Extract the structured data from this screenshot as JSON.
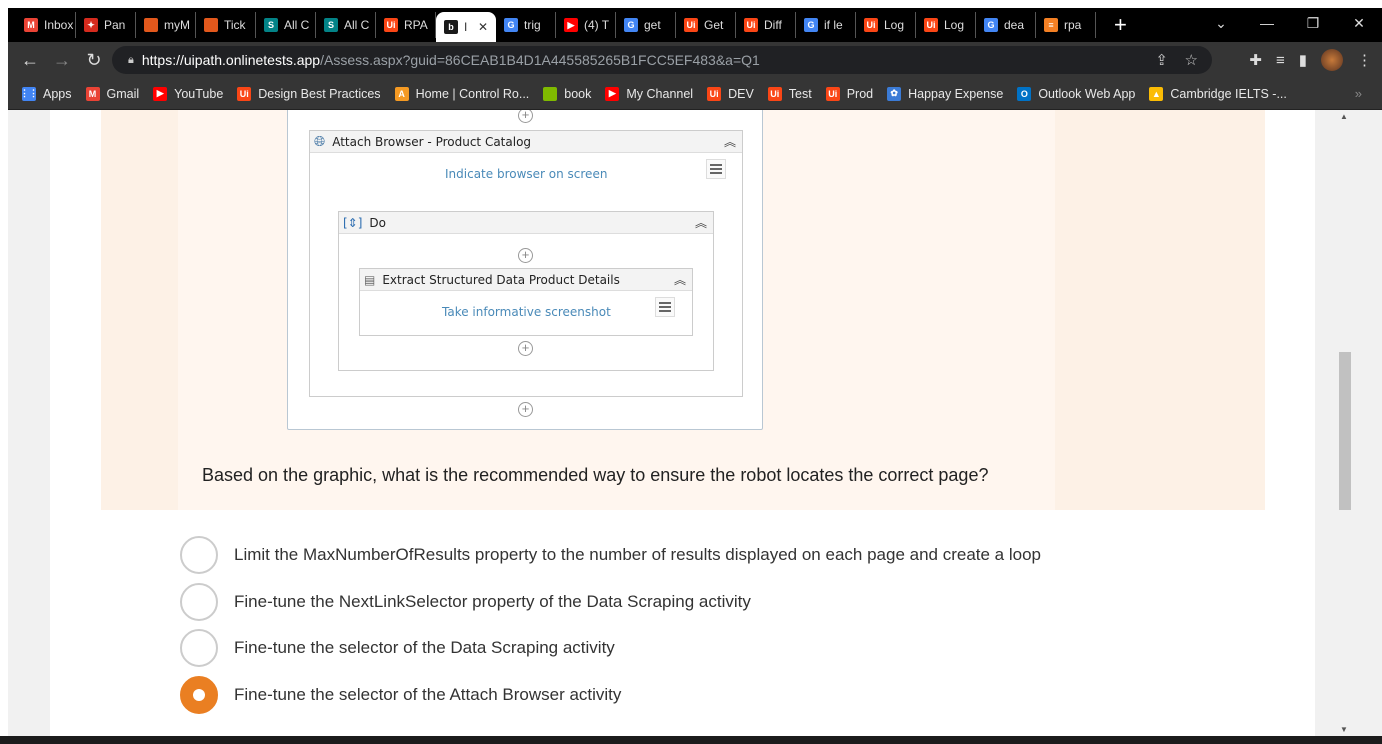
{
  "browser": {
    "tabs": [
      {
        "label": "Inbox",
        "icon": "gmail-icon",
        "color": "#ea4335"
      },
      {
        "label": "Pan",
        "icon": "maple-leaf-icon",
        "color": "#d52b1e"
      },
      {
        "label": "myM",
        "icon": "office-icon",
        "color": "#e2581c"
      },
      {
        "label": "Tick",
        "icon": "office-icon",
        "color": "#e2581c"
      },
      {
        "label": "All C",
        "icon": "sharepoint-icon",
        "color": "#038387"
      },
      {
        "label": "All C",
        "icon": "sharepoint-icon",
        "color": "#038387"
      },
      {
        "label": "RPA",
        "icon": "uipath-icon",
        "color": "#fa4616"
      },
      {
        "label": "I",
        "icon": "onlinetests-icon",
        "color": "#1a1a1a",
        "active": true
      },
      {
        "label": "trig",
        "icon": "google-icon",
        "color": "#4285f4"
      },
      {
        "label": "(4) T",
        "icon": "youtube-icon",
        "color": "#ff0000"
      },
      {
        "label": "get",
        "icon": "google-icon",
        "color": "#4285f4"
      },
      {
        "label": "Get",
        "icon": "uipath-icon",
        "color": "#fa4616"
      },
      {
        "label": "Diff",
        "icon": "uipath-icon",
        "color": "#fa4616"
      },
      {
        "label": "if le",
        "icon": "google-icon",
        "color": "#4285f4"
      },
      {
        "label": "Log",
        "icon": "uipath-icon",
        "color": "#fa4616"
      },
      {
        "label": "Log",
        "icon": "uipath-icon",
        "color": "#fa4616"
      },
      {
        "label": "dea",
        "icon": "google-icon",
        "color": "#4285f4"
      },
      {
        "label": "rpa",
        "icon": "stackoverflow-icon",
        "color": "#f48024"
      }
    ],
    "close_tab": "✕",
    "new_tab": "+",
    "url_host": "https://uipath.onlinetests.app",
    "url_path": "/Assess.aspx?guid=86CEAB1B4D1A445585265B1FCC5EF483&a=Q1",
    "bookmarks": [
      {
        "label": "Apps",
        "icon": "apps-grid-icon",
        "color": "#4285f4"
      },
      {
        "label": "Gmail",
        "icon": "gmail-icon",
        "color": "#ea4335"
      },
      {
        "label": "YouTube",
        "icon": "youtube-icon",
        "color": "#ff0000"
      },
      {
        "label": "Design Best Practices",
        "icon": "uipath-icon",
        "color": "#fa4616"
      },
      {
        "label": "Home | Control Ro...",
        "icon": "automation-anywhere-icon",
        "color": "#f59a23"
      },
      {
        "label": "book",
        "icon": "microsoft-icon",
        "color": "#7fba00"
      },
      {
        "label": "My Channel",
        "icon": "youtube-icon",
        "color": "#ff0000"
      },
      {
        "label": "DEV",
        "icon": "uipath-icon",
        "color": "#fa4616"
      },
      {
        "label": "Test",
        "icon": "uipath-icon",
        "color": "#fa4616"
      },
      {
        "label": "Prod",
        "icon": "uipath-icon",
        "color": "#fa4616"
      },
      {
        "label": "Happay Expense",
        "icon": "happay-icon",
        "color": "#3b7bd6"
      },
      {
        "label": "Outlook Web App",
        "icon": "outlook-icon",
        "color": "#0072c6"
      },
      {
        "label": "Cambridge IELTS -...",
        "icon": "google-drive-icon",
        "color": "#fbbc04"
      }
    ]
  },
  "diagram": {
    "attach_title": "Attach Browser - Product Catalog",
    "attach_link": "Indicate browser on screen",
    "do_title": "Do",
    "extract_title": "Extract Structured Data Product Details",
    "extract_link": "Take informative screenshot"
  },
  "question": "Based on the graphic, what is the recommended way to ensure the robot locates the correct page?",
  "options": [
    {
      "label": "Limit the MaxNumberOfResults property to the number of results displayed on each page and create a loop",
      "selected": false
    },
    {
      "label": "Fine-tune the NextLinkSelector property of the Data Scraping activity",
      "selected": false
    },
    {
      "label": "Fine-tune the selector of the Data Scraping activity",
      "selected": false
    },
    {
      "label": "Fine-tune the selector of the Attach Browser activity",
      "selected": true
    }
  ],
  "accent": "#ea7f22"
}
